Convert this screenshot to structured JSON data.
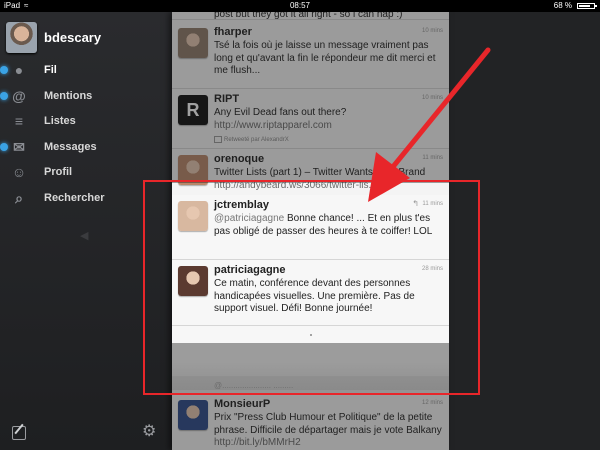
{
  "status_bar": {
    "carrier": "iPad",
    "time": "08:57",
    "battery": "68 %"
  },
  "sidebar": {
    "username": "bdescary",
    "items": [
      {
        "label": "Fil",
        "icon": "speech-bubble-icon",
        "glyph": "●",
        "active": true,
        "unread": true
      },
      {
        "label": "Mentions",
        "icon": "at-sign-icon",
        "glyph": "@",
        "active": false,
        "unread": true
      },
      {
        "label": "Listes",
        "icon": "list-icon",
        "glyph": "≡",
        "active": false,
        "unread": false
      },
      {
        "label": "Messages",
        "icon": "envelope-icon",
        "glyph": "✉",
        "active": false,
        "unread": true
      },
      {
        "label": "Profil",
        "icon": "person-icon",
        "glyph": "☺",
        "active": false,
        "unread": false
      },
      {
        "label": "Rechercher",
        "icon": "search-icon",
        "glyph": "⌕",
        "active": false,
        "unread": false
      }
    ]
  },
  "timeline": {
    "top_fragment": "post but they got it all right - so i can nap :)",
    "tweets": [
      {
        "user": "fharper",
        "time": "10 mins",
        "text": "Tsé la fois où je laisse un message vraiment pas long et qu'avant la fin le répondeur me dit merci et me flush...",
        "avatar_color": "#8f7a6a"
      },
      {
        "user": "RIPT",
        "time": "10 mins",
        "text": "Any Evil Dead fans out there? ",
        "link": "http://www.riptapparel.com",
        "retweet": "Retweeté par AlexandrX",
        "avatar_color": "#111111"
      },
      {
        "user": "orenoque",
        "time": "11 mins",
        "text": "Twitter Lists (part 1) – Twitter Wants Your Brand ",
        "link": "http://andybeard.ws/3066/twitter-lis...",
        "avatar_color": "#b9876a"
      },
      {
        "user": "jctremblay",
        "time": "11 mins",
        "mention": "@patriciagagne",
        "text": " Bonne chance! ... Et en plus t'es pas obligé de passer des heures à te coiffer! LOL",
        "avatar_color": "#d8b8a0"
      },
      {
        "user": "patriciagagne",
        "time": "28 mins",
        "text": "Ce matin, conférence devant des personnes handicapées visuelles.  Une première. Pas de support visuel.  Défi! Bonne journée!",
        "avatar_color": "#5b3a30"
      },
      {
        "user": "MonsieurP",
        "time": "12 mins",
        "text": "Prix \"Press Club Humour et Politique\" de la petite phrase. Difficile de départager mais je vote Balkany ",
        "link": "http://bit.ly/bMMrH2",
        "avatar_color": "#2d4b8a"
      }
    ],
    "hidden_fragment": "@...................... ........."
  },
  "colors": {
    "highlight": "#e8262a",
    "accent_blue": "#3aa3e6"
  }
}
